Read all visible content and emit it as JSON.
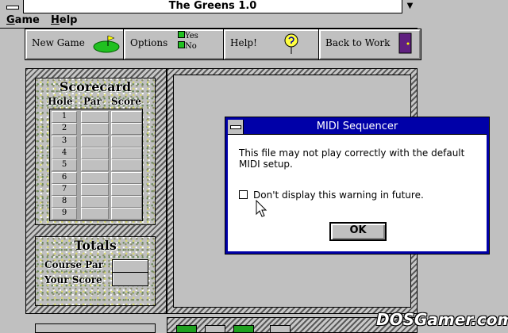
{
  "window": {
    "title": "The Greens 1.0",
    "maximize_glyph": "▼"
  },
  "menu": [
    {
      "label": "Game",
      "underline": "G",
      "rest": "ame"
    },
    {
      "label": "Help",
      "underline": "H",
      "rest": "elp"
    }
  ],
  "toolbar": {
    "new_game": "New Game",
    "options": "Options",
    "options_yes": "Yes",
    "options_no": "No",
    "help": "Help!",
    "back_to_work": "Back to Work"
  },
  "scorecard": {
    "title": "Scorecard",
    "headers": [
      "Hole",
      "Par",
      "Score"
    ],
    "holes": [
      "1",
      "2",
      "3",
      "4",
      "5",
      "6",
      "7",
      "8",
      "9"
    ]
  },
  "totals": {
    "title": "Totals",
    "course_par": "Course Par",
    "your_score": "Your Score"
  },
  "dialog": {
    "title": "MIDI Sequencer",
    "message": "This file may not play correctly with the default MIDI setup.",
    "checkbox_label": "Don't display this warning in future.",
    "ok": "OK"
  },
  "watermark": "DOSGamer.com",
  "colors": {
    "dialog_frame": "#0000a8",
    "face": "#c0c0c0"
  }
}
